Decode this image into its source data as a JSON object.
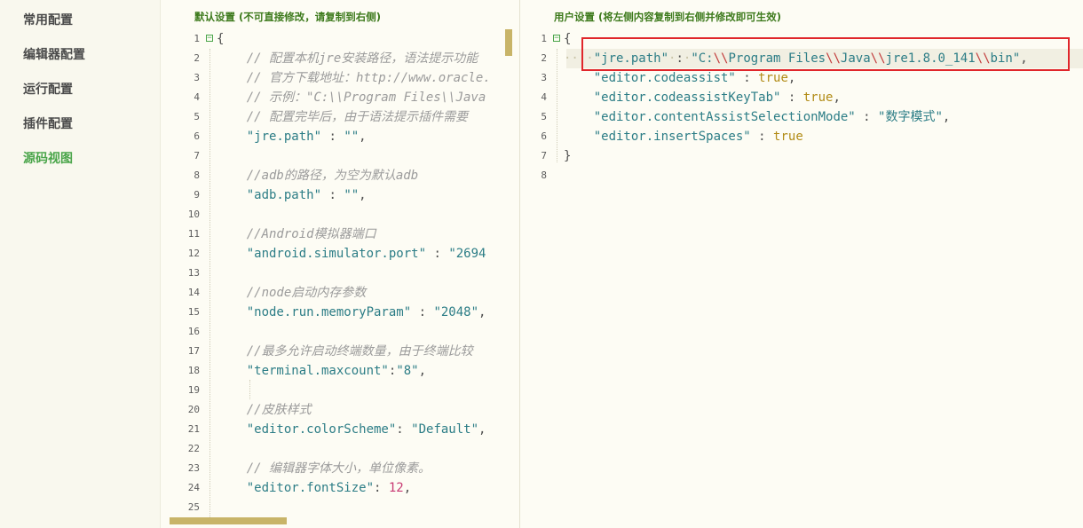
{
  "nav": {
    "items": [
      "常用配置",
      "编辑器配置",
      "运行配置",
      "插件配置",
      "源码视图"
    ],
    "active_index": 4
  },
  "left_panel": {
    "title": "默认设置 (不可直接修改，请复制到右侧)",
    "lines": [
      {
        "n": "1",
        "fold": "⊟",
        "tokens": [
          [
            "p",
            "{"
          ]
        ]
      },
      {
        "n": "2",
        "tokens": [
          [
            "p",
            "    "
          ],
          [
            "c",
            "// 配置本机jre安装路径，语法提示功能"
          ]
        ]
      },
      {
        "n": "3",
        "tokens": [
          [
            "p",
            "    "
          ],
          [
            "c",
            "// 官方下载地址：http://www.oracle."
          ]
        ]
      },
      {
        "n": "4",
        "tokens": [
          [
            "p",
            "    "
          ],
          [
            "c",
            "// 示例：\"C:\\\\Program Files\\\\Java"
          ]
        ]
      },
      {
        "n": "5",
        "tokens": [
          [
            "p",
            "    "
          ],
          [
            "c",
            "// 配置完毕后，由于语法提示插件需要"
          ]
        ]
      },
      {
        "n": "6",
        "tokens": [
          [
            "p",
            "    "
          ],
          [
            "s",
            "\"jre.path\""
          ],
          [
            "p",
            " : "
          ],
          [
            "s",
            "\"\""
          ],
          [
            "p",
            ","
          ]
        ]
      },
      {
        "n": "7",
        "tokens": []
      },
      {
        "n": "8",
        "tokens": [
          [
            "p",
            "    "
          ],
          [
            "c",
            "//adb的路径，为空为默认adb"
          ]
        ]
      },
      {
        "n": "9",
        "tokens": [
          [
            "p",
            "    "
          ],
          [
            "s",
            "\"adb.path\""
          ],
          [
            "p",
            " : "
          ],
          [
            "s",
            "\"\""
          ],
          [
            "p",
            ","
          ]
        ]
      },
      {
        "n": "10",
        "tokens": []
      },
      {
        "n": "11",
        "tokens": [
          [
            "p",
            "    "
          ],
          [
            "c",
            "//Android模拟器端口"
          ]
        ]
      },
      {
        "n": "12",
        "tokens": [
          [
            "p",
            "    "
          ],
          [
            "s",
            "\"android.simulator.port\""
          ],
          [
            "p",
            " : "
          ],
          [
            "s",
            "\"2694"
          ]
        ]
      },
      {
        "n": "13",
        "tokens": []
      },
      {
        "n": "14",
        "tokens": [
          [
            "p",
            "    "
          ],
          [
            "c",
            "//node启动内存参数"
          ]
        ]
      },
      {
        "n": "15",
        "tokens": [
          [
            "p",
            "    "
          ],
          [
            "s",
            "\"node.run.memoryParam\""
          ],
          [
            "p",
            " : "
          ],
          [
            "s",
            "\"2048\""
          ],
          [
            "p",
            ","
          ]
        ]
      },
      {
        "n": "16",
        "tokens": []
      },
      {
        "n": "17",
        "tokens": [
          [
            "p",
            "    "
          ],
          [
            "c",
            "//最多允许启动终端数量，由于终端比较"
          ]
        ]
      },
      {
        "n": "18",
        "tokens": [
          [
            "p",
            "    "
          ],
          [
            "s",
            "\"terminal.maxcount\""
          ],
          [
            "p",
            ":"
          ],
          [
            "s",
            "\"8\""
          ],
          [
            "p",
            ","
          ]
        ]
      },
      {
        "n": "19",
        "tokens": []
      },
      {
        "n": "20",
        "tokens": [
          [
            "p",
            "    "
          ],
          [
            "c",
            "//皮肤样式"
          ]
        ]
      },
      {
        "n": "21",
        "tokens": [
          [
            "p",
            "    "
          ],
          [
            "s",
            "\"editor.colorScheme\""
          ],
          [
            "p",
            ": "
          ],
          [
            "s",
            "\"Default\""
          ],
          [
            "p",
            ","
          ]
        ]
      },
      {
        "n": "22",
        "tokens": []
      },
      {
        "n": "23",
        "tokens": [
          [
            "p",
            "    "
          ],
          [
            "c",
            "// 编辑器字体大小，单位像素。"
          ]
        ]
      },
      {
        "n": "24",
        "tokens": [
          [
            "p",
            "    "
          ],
          [
            "s",
            "\"editor.fontSize\""
          ],
          [
            "p",
            ": "
          ],
          [
            "n",
            "12"
          ],
          [
            "p",
            ","
          ]
        ]
      },
      {
        "n": "25",
        "tokens": []
      }
    ]
  },
  "right_panel": {
    "title": "用户设置 (将左侧内容复制到右侧并修改即可生效)",
    "lines": [
      {
        "n": "1",
        "fold": "⊟",
        "tokens": [
          [
            "p",
            "{"
          ]
        ]
      },
      {
        "n": "2",
        "tokens": [
          [
            "dots",
            "····"
          ],
          [
            "s",
            "\"jre.path\""
          ],
          [
            "dots",
            "·"
          ],
          [
            "p",
            ":"
          ],
          [
            "dots",
            "·"
          ],
          [
            "s",
            "\"C:"
          ],
          [
            "bk",
            "\\\\"
          ],
          [
            "s",
            "Program Files"
          ],
          [
            "bk",
            "\\\\"
          ],
          [
            "s",
            "Java"
          ],
          [
            "bk",
            "\\\\"
          ],
          [
            "s",
            "jre1.8.0_141"
          ],
          [
            "bk",
            "\\\\"
          ],
          [
            "s",
            "bin\""
          ],
          [
            "p",
            ","
          ]
        ]
      },
      {
        "n": "3",
        "tokens": [
          [
            "p",
            "    "
          ],
          [
            "s",
            "\"editor.codeassist\""
          ],
          [
            "p",
            " : "
          ],
          [
            "k",
            "true"
          ],
          [
            "p",
            ","
          ]
        ]
      },
      {
        "n": "4",
        "tokens": [
          [
            "p",
            "    "
          ],
          [
            "s",
            "\"editor.codeassistKeyTab\""
          ],
          [
            "p",
            " : "
          ],
          [
            "k",
            "true"
          ],
          [
            "p",
            ","
          ]
        ]
      },
      {
        "n": "5",
        "tokens": [
          [
            "p",
            "    "
          ],
          [
            "s",
            "\"editor.contentAssistSelectionMode\""
          ],
          [
            "p",
            " : "
          ],
          [
            "s",
            "\"数字模式\""
          ],
          [
            "p",
            ","
          ]
        ]
      },
      {
        "n": "6",
        "tokens": [
          [
            "p",
            "    "
          ],
          [
            "s",
            "\"editor.insertSpaces\""
          ],
          [
            "p",
            " : "
          ],
          [
            "k",
            "true"
          ]
        ]
      },
      {
        "n": "7",
        "tokens": [
          [
            "p",
            "}"
          ]
        ]
      },
      {
        "n": "8",
        "tokens": []
      }
    ]
  }
}
